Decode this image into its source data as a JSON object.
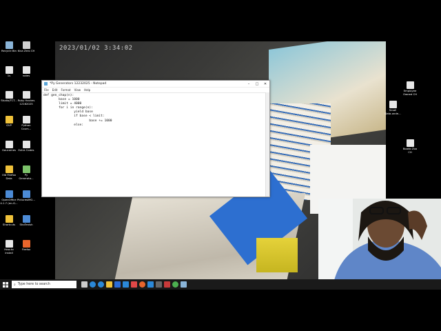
{
  "camera": {
    "timestamp": "2023/01/02 3:34:02"
  },
  "notepad": {
    "title": "*Py Generators 12232025 - Notepad",
    "menu": [
      "File",
      "Edit",
      "Format",
      "View",
      "Help"
    ],
    "code": "def gen_chap(n):\n        base = 1000\n        limit = 4000\n        for i in range(n):\n                yield base\n                if base < limit:\n                        base += 1000\n                else:"
  },
  "desktop_icons_left": [
    {
      "label": "Recycle Bin",
      "color": "#8ab4d8"
    },
    {
      "label": "Kiva Zero CH",
      "color": "#d0d0d0"
    },
    {
      "label": "1s",
      "color": "#e6e6e6"
    },
    {
      "label": "notes",
      "color": "#e6e6e6"
    },
    {
      "label": "Studio/TCT...",
      "color": "#e6e6e6"
    },
    {
      "label": "Ruby Hashes\n12162025",
      "color": "#e6e6e6"
    },
    {
      "label": "GVP",
      "color": "#f0c23a"
    },
    {
      "label": "Python\nCours...",
      "color": "#e6e6e6"
    },
    {
      "label": "Gaucomes",
      "color": "#e6e6e6"
    },
    {
      "label": "Extra Codes",
      "color": "#e6e6e6"
    },
    {
      "label": "Old Firefox\nData",
      "color": "#f0c23a"
    },
    {
      "label": "Py\nGenerato...",
      "color": "#7cc26a"
    },
    {
      "label": "OpenOffice\n4.1.7 (en-G...",
      "color": "#4c8bd6"
    },
    {
      "label": "PicturesIMG...",
      "color": "#4c8bd6"
    },
    {
      "label": "Shortcuts",
      "color": "#f0c23a"
    },
    {
      "label": "ShoTenish",
      "color": "#4c8bd6"
    },
    {
      "label": "How-to\ninstall",
      "color": "#e6e6e6"
    },
    {
      "label": "Firefox",
      "color": "#e8652c"
    }
  ],
  "desktop_icons_right": [
    {
      "label": "Employee\nOwned CH",
      "color": "#e6e6e6"
    },
    {
      "label": "Small\nData.onde...",
      "color": "#e6e6e6"
    },
    {
      "label": "Bookb Zoo\nCH",
      "color": "#e6e6e6"
    }
  ],
  "taskbar": {
    "search_placeholder": "Type here to search",
    "icons": [
      "task-view-icon",
      "edge-icon",
      "chrome-icon",
      "file-explorer-icon",
      "store-icon",
      "mail-icon",
      "app-icon",
      "firefox-icon",
      "photos-icon",
      "terminal-icon",
      "app2-icon",
      "chrome2-icon",
      "notepad-icon"
    ],
    "icon_colors": [
      "#cccccc",
      "#2b88d8",
      "#2b88d8",
      "#f0c23a",
      "#2b6cd8",
      "#2b88d8",
      "#e04848",
      "#e8652c",
      "#2b88d8",
      "#666666",
      "#c83a3a",
      "#4caf50",
      "#8ab4d8"
    ]
  }
}
